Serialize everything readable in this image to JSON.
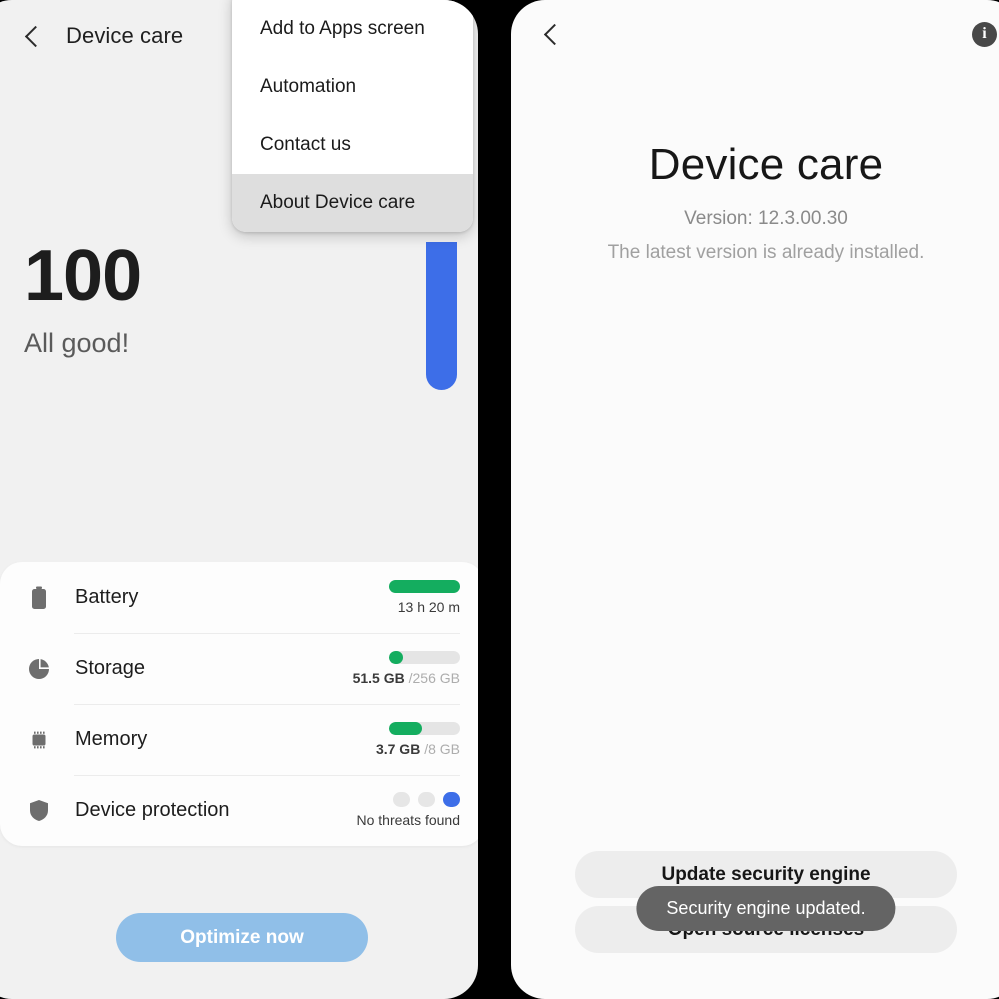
{
  "theme": {
    "panel_left_bg": "#f1f1f1",
    "panel_right_bg": "#fbfbfb",
    "gauge_blue": "#3d6ee8",
    "bar_green": "#14ad5f",
    "bar_track": "#e5e5e5",
    "optimize_blue": "#90bfe8",
    "toast_bg": "#646464",
    "menu_selected_bg": "#dedede"
  },
  "left_screen": {
    "app_bar": {
      "back_icon": "chevron-left-icon",
      "title": "Device care"
    },
    "score": {
      "value": "100",
      "status": "All good!"
    },
    "overflow_menu": {
      "items": [
        {
          "label": "Add to Apps screen",
          "selected": false
        },
        {
          "label": "Automation",
          "selected": false
        },
        {
          "label": "Contact us",
          "selected": false
        },
        {
          "label": "About Device care",
          "selected": true
        }
      ]
    },
    "status_card": {
      "rows": [
        {
          "icon": "battery-icon",
          "label": "Battery",
          "value": "13 h 20 m",
          "value_muted": "",
          "bar_type": "full",
          "bar_percent": 100
        },
        {
          "icon": "storage-pie-icon",
          "label": "Storage",
          "value": "51.5 GB",
          "value_muted": " /256 GB",
          "bar_type": "partial",
          "bar_percent": 20
        },
        {
          "icon": "memory-chip-icon",
          "label": "Memory",
          "value": "3.7 GB",
          "value_muted": " /8 GB",
          "bar_type": "partial",
          "bar_percent": 46
        },
        {
          "icon": "shield-icon",
          "label": "Device protection",
          "value": "No threats found",
          "value_muted": "",
          "bar_type": "dots",
          "dots": [
            "inactive",
            "inactive",
            "active"
          ]
        }
      ]
    },
    "optimize_button": {
      "label": "Optimize now"
    }
  },
  "right_screen": {
    "app_bar": {
      "back_icon": "chevron-left-icon",
      "info_icon": "info-icon",
      "info_glyph": "i"
    },
    "about": {
      "title": "Device care",
      "version": "Version: 12.3.00.30",
      "subtitle": "The latest version is already installed."
    },
    "buttons": [
      {
        "label": "Update security engine"
      },
      {
        "label": "Open source licenses"
      }
    ],
    "toast": {
      "message": "Security engine updated."
    }
  }
}
